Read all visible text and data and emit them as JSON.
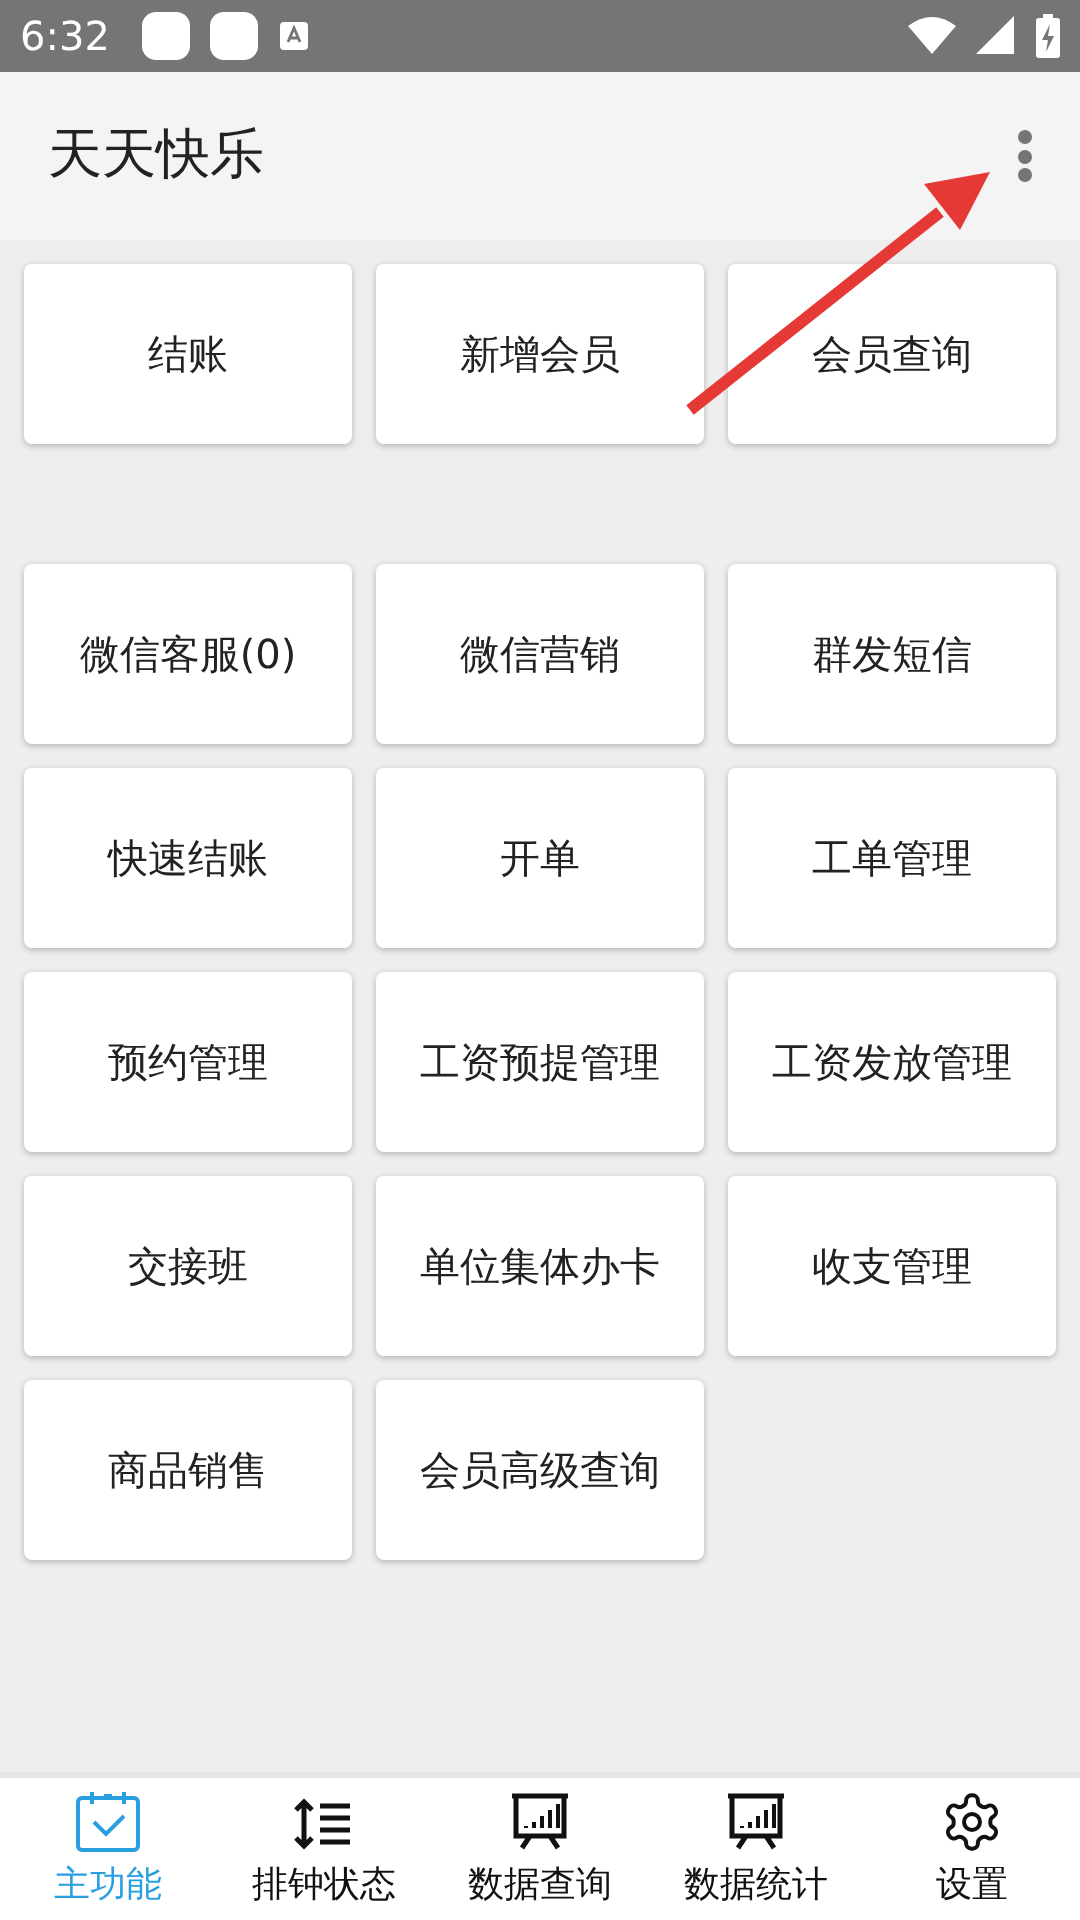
{
  "status_bar": {
    "time": "6:32"
  },
  "app_bar": {
    "title": "天天快乐"
  },
  "tile_groups": [
    {
      "tiles": [
        "结账",
        "新增会员",
        "会员查询"
      ]
    },
    {
      "tiles": [
        "微信客服(0)",
        "微信营销",
        "群发短信",
        "快速结账",
        "开单",
        "工单管理",
        "预约管理",
        "工资预提管理",
        "工资发放管理",
        "交接班",
        "单位集体办卡",
        "收支管理",
        "商品销售",
        "会员高级查询"
      ]
    }
  ],
  "bottom_nav": [
    {
      "label": "主功能",
      "kind": "calendar",
      "selected": true
    },
    {
      "label": "排钟状态",
      "kind": "sort",
      "selected": false
    },
    {
      "label": "数据查询",
      "kind": "chart",
      "selected": false
    },
    {
      "label": "数据统计",
      "kind": "chart",
      "selected": false
    },
    {
      "label": "设置",
      "kind": "gear",
      "selected": false
    }
  ]
}
